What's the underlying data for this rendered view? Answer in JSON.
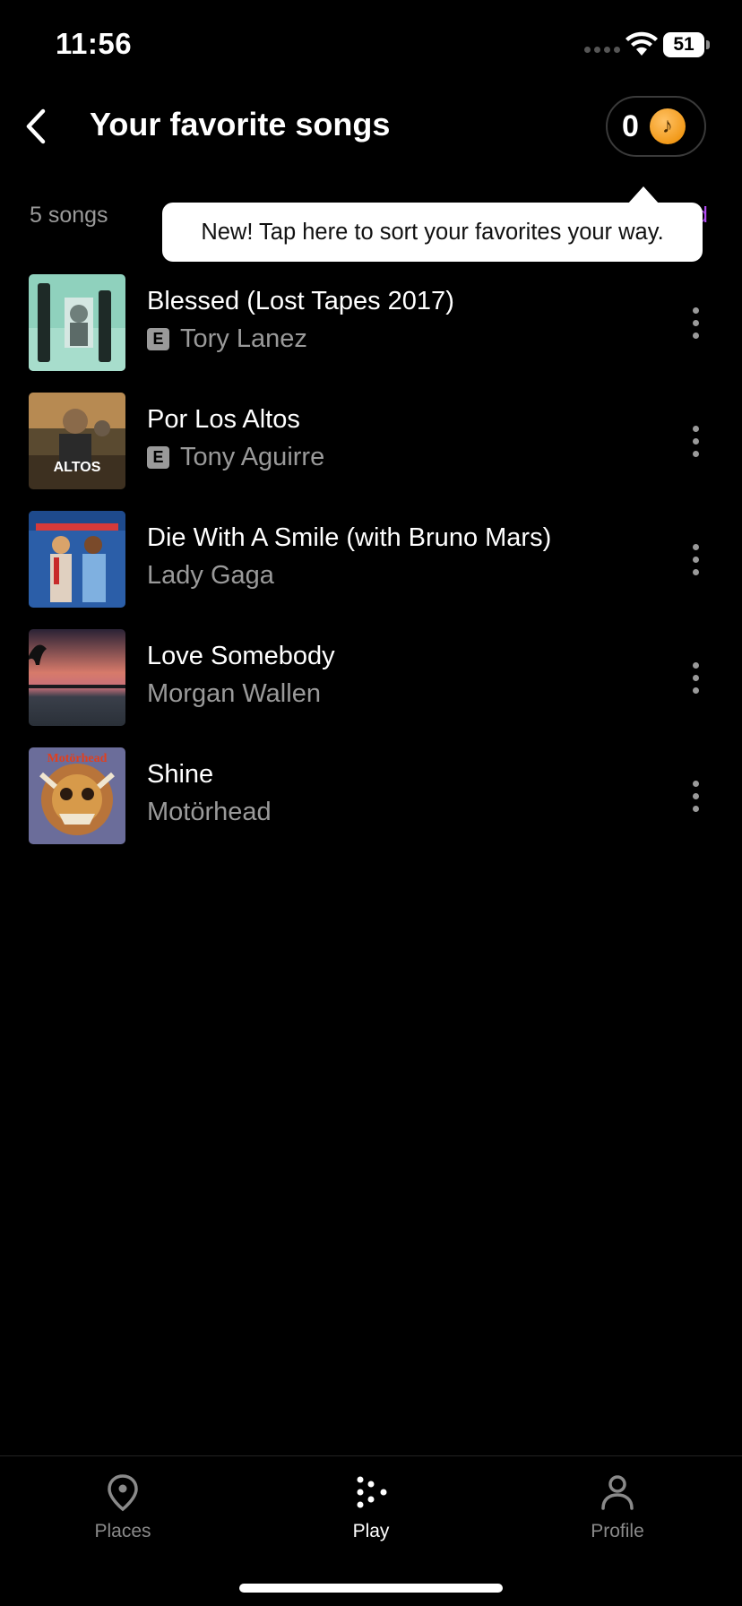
{
  "status_bar": {
    "time": "11:56",
    "battery": "51"
  },
  "header": {
    "title": "Your favorite songs",
    "coin_count": "0"
  },
  "subheader": {
    "song_count": "5 songs",
    "sort_label_visible": "d"
  },
  "tooltip": {
    "text": "New! Tap here to sort your favorites your way."
  },
  "songs": [
    {
      "title": "Blessed (Lost Tapes 2017)",
      "artist": "Tory Lanez",
      "explicit": true,
      "explicit_label": "E"
    },
    {
      "title": "Por Los Altos",
      "artist": "Tony Aguirre",
      "explicit": true,
      "explicit_label": "E"
    },
    {
      "title": "Die With A Smile (with Bruno Mars)",
      "artist": "Lady Gaga",
      "explicit": false
    },
    {
      "title": "Love Somebody",
      "artist": "Morgan Wallen",
      "explicit": false
    },
    {
      "title": "Shine",
      "artist": "Motörhead",
      "explicit": false
    }
  ],
  "nav": {
    "places": "Places",
    "play": "Play",
    "profile": "Profile",
    "active": "play"
  },
  "colors": {
    "accent": "#b24bf3",
    "coin": "#f29a1a",
    "muted_text": "#9a9a9a"
  }
}
